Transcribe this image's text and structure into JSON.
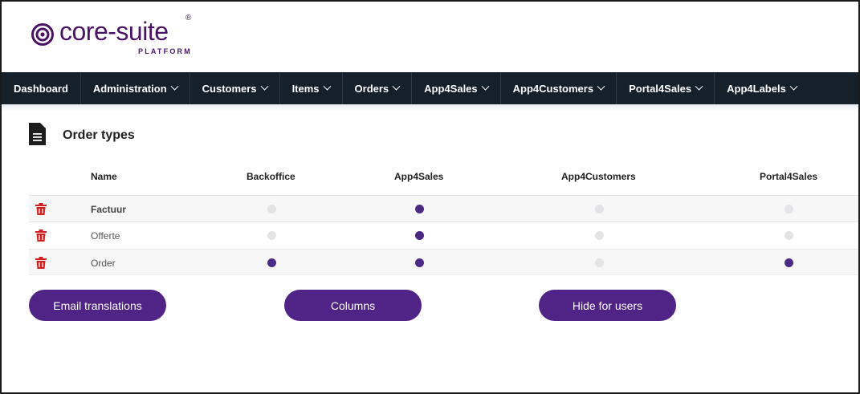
{
  "brand": {
    "name": "core-suite",
    "registered": "®",
    "tagline": "PLATFORM",
    "color": "#4a1466"
  },
  "nav": {
    "items": [
      {
        "label": "Dashboard",
        "dropdown": false
      },
      {
        "label": "Administration",
        "dropdown": true
      },
      {
        "label": "Customers",
        "dropdown": true
      },
      {
        "label": "Items",
        "dropdown": true
      },
      {
        "label": "Orders",
        "dropdown": true
      },
      {
        "label": "App4Sales",
        "dropdown": true
      },
      {
        "label": "App4Customers",
        "dropdown": true
      },
      {
        "label": "Portal4Sales",
        "dropdown": true
      },
      {
        "label": "App4Labels",
        "dropdown": true
      }
    ]
  },
  "page": {
    "title": "Order types",
    "icon": "document-icon"
  },
  "table": {
    "columns": [
      "Name",
      "Backoffice",
      "App4Sales",
      "App4Customers",
      "Portal4Sales"
    ],
    "rows": [
      {
        "name": "Factuur",
        "bold": true,
        "backoffice": false,
        "app4sales": true,
        "app4customers": false,
        "portal4sales": false
      },
      {
        "name": "Offerte",
        "bold": false,
        "backoffice": false,
        "app4sales": true,
        "app4customers": false,
        "portal4sales": false
      },
      {
        "name": "Order",
        "bold": false,
        "backoffice": true,
        "app4sales": true,
        "app4customers": false,
        "portal4sales": true
      }
    ]
  },
  "buttons": {
    "email_translations": "Email translations",
    "columns": "Columns",
    "hide_for_users": "Hide for users"
  },
  "colors": {
    "nav_bg": "#16202b",
    "accent": "#4f2486",
    "dot_on": "#4b2a86",
    "dot_off": "#e4e4e6",
    "trash": "#d21f1f"
  }
}
